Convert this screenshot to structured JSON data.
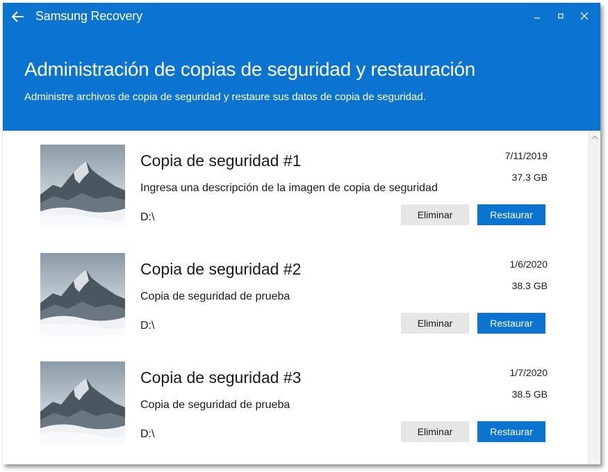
{
  "app": {
    "title": "Samsung Recovery",
    "accent_color": "#0a74d0"
  },
  "header": {
    "title": "Administración de copias de seguridad y restauración",
    "subtitle": "Administre archivos de copia de seguridad y restaure sus datos de copia de seguridad."
  },
  "window_controls": {
    "icons": [
      "minimize-icon",
      "maximize-icon",
      "close-icon"
    ]
  },
  "backups": [
    {
      "title": "Copia de seguridad #1",
      "description": "Ingresa una descripción de la imagen de copia de seguridad",
      "drive": "D:\\",
      "date": "7/11/2019",
      "size": "37.3 GB",
      "delete_label": "Eliminar",
      "restore_label": "Restaurar"
    },
    {
      "title": "Copia de seguridad #2",
      "description": "Copia de seguridad de prueba",
      "drive": "D:\\",
      "date": "1/6/2020",
      "size": "38.3 GB",
      "delete_label": "Eliminar",
      "restore_label": "Restaurar"
    },
    {
      "title": "Copia de seguridad #3",
      "description": "Copia de seguridad de prueba",
      "drive": "D:\\",
      "date": "1/7/2020",
      "size": "38.5 GB",
      "delete_label": "Eliminar",
      "restore_label": "Restaurar"
    }
  ]
}
